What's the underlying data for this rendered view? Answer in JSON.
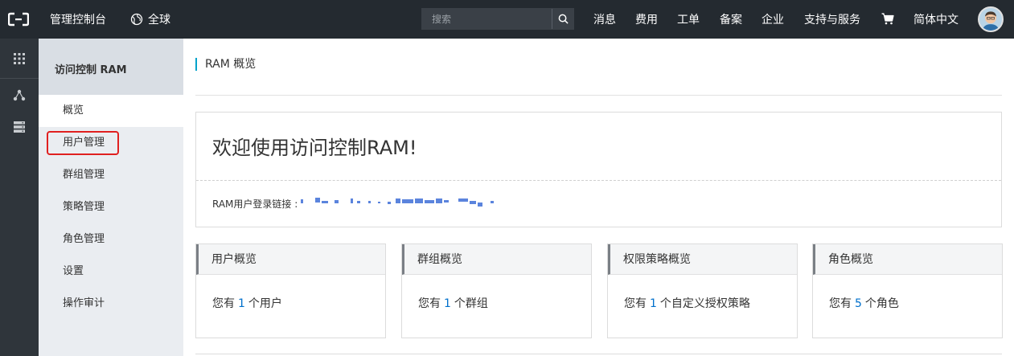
{
  "topbar": {
    "console_title": "管理控制台",
    "region": "全球",
    "search_placeholder": "搜索",
    "nav": [
      "消息",
      "费用",
      "工单",
      "备案",
      "企业",
      "支持与服务"
    ],
    "language": "简体中文"
  },
  "sidebar": {
    "title": "访问控制 RAM",
    "items": [
      {
        "label": "概览"
      },
      {
        "label": "用户管理"
      },
      {
        "label": "群组管理"
      },
      {
        "label": "策略管理"
      },
      {
        "label": "角色管理"
      },
      {
        "label": "设置"
      },
      {
        "label": "操作审计"
      }
    ]
  },
  "main": {
    "page_title": "RAM 概览",
    "welcome_title": "欢迎使用访问控制RAM!",
    "login_label": "RAM用户登录链接 :",
    "cards": [
      {
        "title": "用户概览",
        "prefix": "您有",
        "count": "1",
        "suffix": "个用户"
      },
      {
        "title": "群组概览",
        "prefix": "您有",
        "count": "1",
        "suffix": "个群组"
      },
      {
        "title": "权限策略概览",
        "prefix": "您有",
        "count": "1",
        "suffix": "个自定义授权策略"
      },
      {
        "title": "角色概览",
        "prefix": "您有",
        "count": "5",
        "suffix": "个角色"
      }
    ]
  },
  "colors": {
    "topbar_bg": "#242a30",
    "accent": "#00a2ca",
    "link": "#0070cc",
    "highlight": "#e02020"
  }
}
